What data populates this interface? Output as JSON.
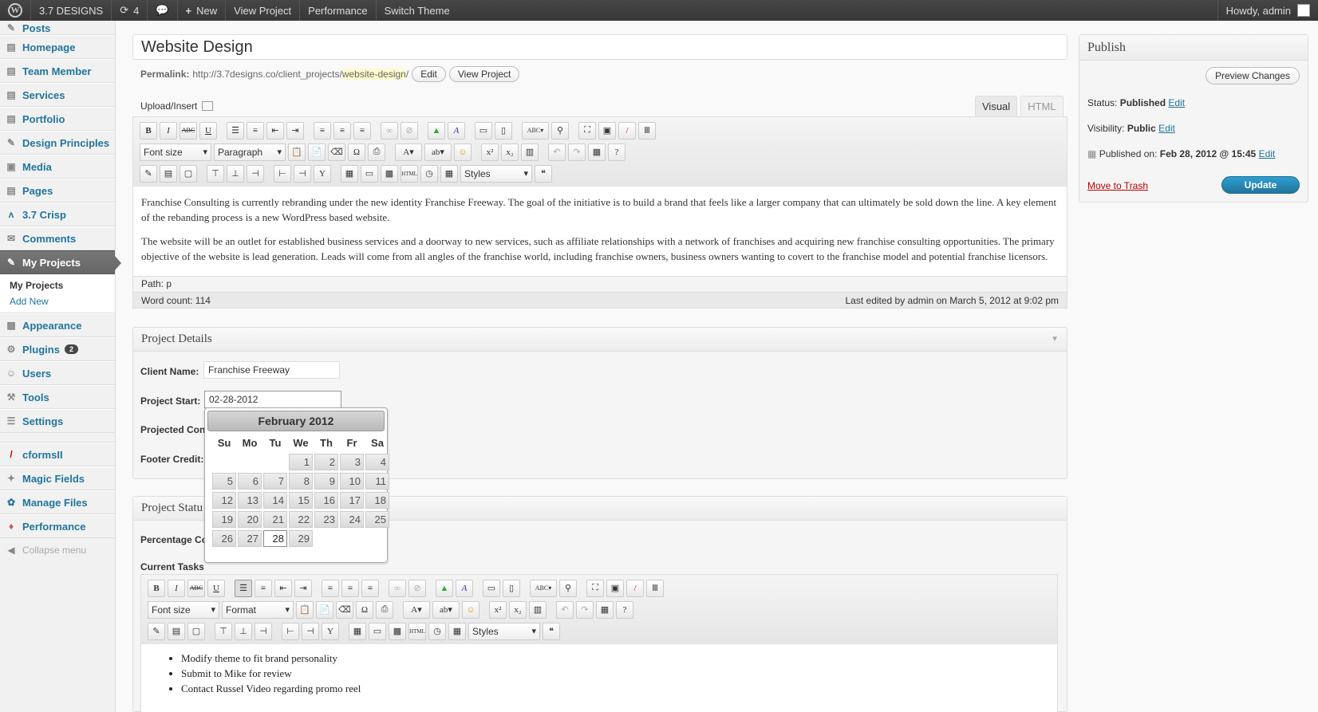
{
  "adminbar": {
    "site_name": "3.7 DESIGNS",
    "updates_count": "4",
    "new_label": "New",
    "view_project": "View Project",
    "performance": "Performance",
    "switch_theme": "Switch Theme",
    "howdy": "Howdy, admin"
  },
  "sidebar": {
    "items": [
      {
        "label": "Posts",
        "icon": "pin-icon"
      },
      {
        "label": "Homepage",
        "icon": "page-icon"
      },
      {
        "label": "Team Member",
        "icon": "page-icon"
      },
      {
        "label": "Services",
        "icon": "page-icon"
      },
      {
        "label": "Portfolio",
        "icon": "page-icon"
      },
      {
        "label": "Design Principles",
        "icon": "pin-icon"
      },
      {
        "label": "Media",
        "icon": "media-icon"
      },
      {
        "label": "Pages",
        "icon": "page-icon"
      },
      {
        "label": "3.7 Crisp",
        "icon": "crisp-icon"
      },
      {
        "label": "Comments",
        "icon": "comments-icon"
      },
      {
        "label": "My Projects",
        "icon": "pin-icon"
      }
    ],
    "submenu": [
      "My Projects",
      "Add New"
    ],
    "items2": [
      {
        "label": "Appearance",
        "icon": "appearance-icon"
      },
      {
        "label": "Plugins",
        "icon": "plugins-icon",
        "badge": "2"
      },
      {
        "label": "Users",
        "icon": "users-icon"
      },
      {
        "label": "Tools",
        "icon": "tools-icon"
      },
      {
        "label": "Settings",
        "icon": "settings-icon"
      }
    ],
    "items3": [
      {
        "label": "cformsII",
        "icon": "cforms-icon"
      },
      {
        "label": "Magic Fields",
        "icon": "magic-icon"
      },
      {
        "label": "Manage Files",
        "icon": "files-icon"
      },
      {
        "label": "Performance",
        "icon": "performance-icon"
      }
    ],
    "collapse": "Collapse menu"
  },
  "post": {
    "title": "Website Design",
    "permalink_label": "Permalink:",
    "permalink_base": "http://3.7designs.co/client_projects/",
    "permalink_slug": "website-design",
    "permalink_tail": "/",
    "edit_button": "Edit",
    "view_button": "View Project",
    "upload_insert": "Upload/Insert",
    "tab_visual": "Visual",
    "tab_html": "HTML"
  },
  "editor": {
    "font_size": "Font size",
    "format": "Paragraph",
    "styles": "Styles",
    "paragraph1": "Franchise Consulting is currently rebranding under the new identity Franchise Freeway. The goal of the initiative is to build a brand that feels like a larger company that can ultimately be sold down the line. A key element of the rebanding process is a new WordPress based website.",
    "paragraph2": "The website will be an outlet for established business services and a doorway to new services, such as affiliate relationships with a network of franchises and acquiring new franchise consulting opportunities. The primary objective of the website is lead generation. Leads will come from all angles of the franchise world, including franchise owners, business owners wanting to covert to the franchise model and potential franchise licensors.",
    "path": "Path: p",
    "word_count": "Word count: 114",
    "last_edited": "Last edited by admin on March 5, 2012 at 9:02 pm"
  },
  "project_details": {
    "title": "Project Details",
    "client_name_label": "Client Name:",
    "client_name_value": "Franchise Freeway",
    "project_start_label": "Project Start:",
    "project_start_value": "02-28-2012",
    "projected_label": "Projected Con",
    "footer_credit_label": "Footer Credit:"
  },
  "datepicker": {
    "month": "February 2012",
    "days": [
      "Su",
      "Mo",
      "Tu",
      "We",
      "Th",
      "Fr",
      "Sa"
    ],
    "dates": [
      "",
      "",
      "",
      "1",
      "2",
      "3",
      "4",
      "5",
      "6",
      "7",
      "8",
      "9",
      "10",
      "11",
      "12",
      "13",
      "14",
      "15",
      "16",
      "17",
      "18",
      "19",
      "20",
      "21",
      "22",
      "23",
      "24",
      "25",
      "26",
      "27",
      "28",
      "29"
    ],
    "selected": "28"
  },
  "project_status": {
    "title": "Project Statu",
    "percentage_label": "Percentage Co",
    "current_tasks_label": "Current Tasks",
    "font_size": "Font size",
    "format": "Format",
    "styles": "Styles",
    "tasks": [
      "Modify theme to fit brand personality",
      "Submit to Mike for review",
      "Contact Russel Video regarding promo reel"
    ]
  },
  "publish": {
    "title": "Publish",
    "preview_button": "Preview Changes",
    "status_label": "Status:",
    "status_value": "Published",
    "visibility_label": "Visibility:",
    "visibility_value": "Public",
    "published_on_label": "Published on:",
    "published_on_value": "Feb 28, 2012 @ 15:45",
    "edit": "Edit",
    "trash": "Move to Trash",
    "update": "Update"
  },
  "colors": {
    "link": "#21759b",
    "update_button": "#21759b",
    "trash": "#bb0000",
    "adminbar": "#464646"
  }
}
